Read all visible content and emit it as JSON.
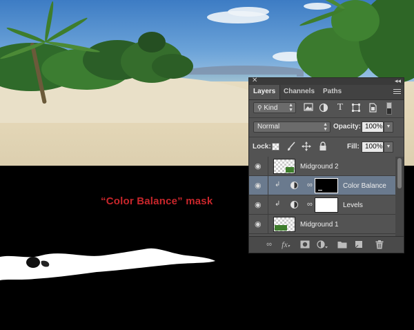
{
  "annotation": "“Color Balance” mask",
  "panel": {
    "close_icon": "✕",
    "collapse_icon": "◂◂",
    "tabs": [
      {
        "label": "Layers",
        "active": true
      },
      {
        "label": "Channels",
        "active": false
      },
      {
        "label": "Paths",
        "active": false
      }
    ],
    "filter": {
      "kind_label": "Kind",
      "icons": [
        "image-filter-icon",
        "adjustment-filter-icon",
        "type-filter-icon",
        "shape-filter-icon",
        "smart-object-filter-icon",
        "filter-toggle-icon"
      ]
    },
    "blend_mode": "Normal",
    "opacity_label": "Opacity:",
    "opacity_value": "100%",
    "lock_label": "Lock:",
    "fill_label": "Fill:",
    "fill_value": "100%",
    "layers": [
      {
        "name": "Midground 2",
        "type": "pixel",
        "selected": false
      },
      {
        "name": "Color Balance",
        "type": "adjustment",
        "selected": true,
        "mask": "black"
      },
      {
        "name": "Levels",
        "type": "adjustment",
        "selected": false,
        "mask": "white"
      },
      {
        "name": "Midground 1",
        "type": "pixel",
        "selected": false
      }
    ],
    "bottom_icons": [
      "link-layers-icon",
      "fx-icon",
      "add-mask-icon",
      "new-adjustment-icon",
      "new-group-icon",
      "new-layer-icon",
      "delete-layer-icon"
    ]
  },
  "colors": {
    "annotation": "#c8262b",
    "panel_bg": "#535353",
    "selected_layer": "#6a7a8e"
  }
}
